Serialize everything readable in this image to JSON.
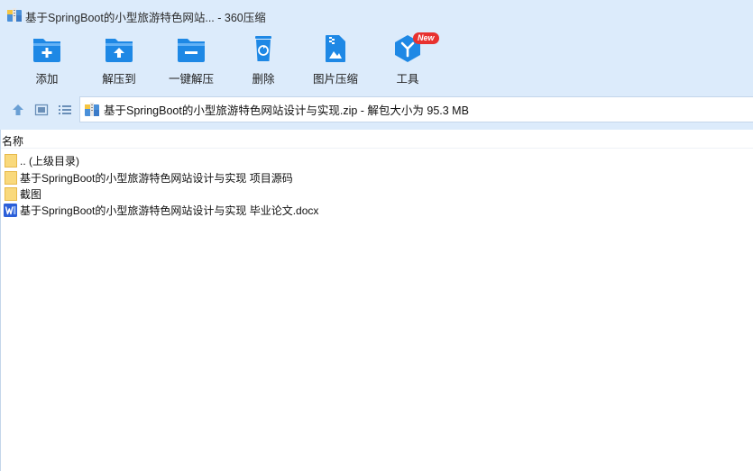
{
  "window": {
    "title": "基于SpringBoot的小型旅游特色网站... - 360压缩"
  },
  "toolbar": {
    "items": [
      {
        "label": "添加",
        "icon": "add-folder-icon"
      },
      {
        "label": "解压到",
        "icon": "extract-to-icon"
      },
      {
        "label": "一键解压",
        "icon": "one-click-extract-icon"
      },
      {
        "label": "删除",
        "icon": "recycle-bin-icon"
      },
      {
        "label": "图片压缩",
        "icon": "image-compress-icon"
      },
      {
        "label": "工具",
        "icon": "tools-cube-icon",
        "badge": "New"
      }
    ]
  },
  "addressbar": {
    "path": "基于SpringBoot的小型旅游特色网站设计与实现.zip - 解包大小为 95.3 MB"
  },
  "filelist": {
    "column_name": "名称",
    "items": [
      {
        "name": ".. (上级目录)",
        "type": "folder"
      },
      {
        "name": "基于SpringBoot的小型旅游特色网站设计与实现 项目源码",
        "type": "folder"
      },
      {
        "name": "截图",
        "type": "folder"
      },
      {
        "name": "基于SpringBoot的小型旅游特色网站设计与实现 毕业论文.docx",
        "type": "word"
      }
    ]
  },
  "colors": {
    "accent": "#1e88e5",
    "header_bg": "#dcebfb",
    "folder": "#f7d46c",
    "word": "#2b5fd9"
  }
}
